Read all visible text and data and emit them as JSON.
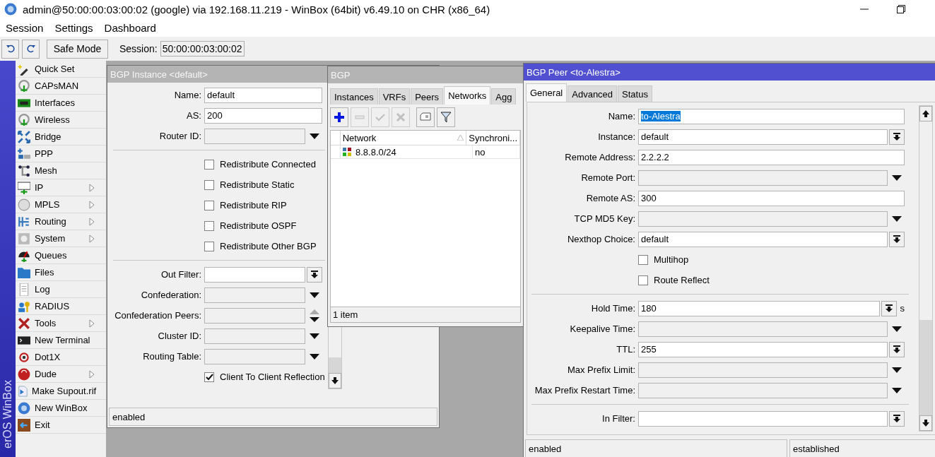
{
  "window": {
    "title": "admin@50:00:00:03:00:02 (google) via 192.168.11.219 - WinBox (64bit) v6.49.10 on CHR (x86_64)"
  },
  "menu": [
    "Session",
    "Settings",
    "Dashboard"
  ],
  "toolbar": {
    "safe_mode": "Safe Mode",
    "session_label": "Session:",
    "session_value": "50:00:00:03:00:02"
  },
  "sidebar": {
    "brand": "erOS WinBox",
    "items": [
      {
        "label": "Quick Set",
        "submenu": false
      },
      {
        "label": "CAPsMAN",
        "submenu": false
      },
      {
        "label": "Interfaces",
        "submenu": false
      },
      {
        "label": "Wireless",
        "submenu": false
      },
      {
        "label": "Bridge",
        "submenu": false
      },
      {
        "label": "PPP",
        "submenu": false
      },
      {
        "label": "Mesh",
        "submenu": false
      },
      {
        "label": "IP",
        "submenu": true
      },
      {
        "label": "MPLS",
        "submenu": true
      },
      {
        "label": "Routing",
        "submenu": true
      },
      {
        "label": "System",
        "submenu": true
      },
      {
        "label": "Queues",
        "submenu": false
      },
      {
        "label": "Files",
        "submenu": false
      },
      {
        "label": "Log",
        "submenu": false
      },
      {
        "label": "RADIUS",
        "submenu": false
      },
      {
        "label": "Tools",
        "submenu": true
      },
      {
        "label": "New Terminal",
        "submenu": false
      },
      {
        "label": "Dot1X",
        "submenu": false
      },
      {
        "label": "Dude",
        "submenu": true
      },
      {
        "label": "Make Supout.rif",
        "submenu": false
      },
      {
        "label": "New WinBox",
        "submenu": false
      },
      {
        "label": "Exit",
        "submenu": false
      }
    ]
  },
  "windows": [
    {
      "kind": "form",
      "title": "BGP Instance <default>",
      "active": false,
      "fields": [
        {
          "kind": "text",
          "label": "Name:",
          "value": "default"
        },
        {
          "kind": "text",
          "label": "AS:",
          "value": "200"
        },
        {
          "kind": "unset",
          "label": "Router ID:"
        },
        {
          "kind": "separator"
        },
        {
          "kind": "checkbox",
          "label": "Redistribute Connected",
          "checked": false
        },
        {
          "kind": "checkbox",
          "label": "Redistribute Static",
          "checked": false
        },
        {
          "kind": "checkbox",
          "label": "Redistribute RIP",
          "checked": false
        },
        {
          "kind": "checkbox",
          "label": "Redistribute OSPF",
          "checked": false
        },
        {
          "kind": "checkbox",
          "label": "Redistribute Other BGP",
          "checked": false
        },
        {
          "kind": "separator"
        },
        {
          "kind": "combo",
          "label": "Out Filter:"
        },
        {
          "kind": "unset",
          "label": "Confederation:"
        },
        {
          "kind": "multi",
          "label": "Confederation Peers:"
        },
        {
          "kind": "unset",
          "label": "Cluster ID:"
        },
        {
          "kind": "unset",
          "label": "Routing Table:"
        },
        {
          "kind": "checkbox",
          "label": "Client To Client Reflection",
          "checked": true
        }
      ],
      "status": [
        "enabled"
      ]
    },
    {
      "kind": "list",
      "title": "BGP",
      "active": false,
      "tabs": [
        {
          "label": "Instances",
          "selected": false
        },
        {
          "label": "VRFs",
          "selected": false
        },
        {
          "label": "Peers",
          "selected": false
        },
        {
          "label": "Networks",
          "selected": true
        },
        {
          "label": "Agg",
          "selected": false
        }
      ],
      "tools": [
        {
          "kind": "add",
          "disabled": false
        },
        {
          "kind": "remove",
          "disabled": true
        },
        {
          "kind": "enable",
          "disabled": true
        },
        {
          "kind": "disable",
          "disabled": true
        },
        {
          "kind": "comment",
          "disabled": false
        },
        {
          "kind": "filter",
          "disabled": false
        }
      ],
      "columns": [
        {
          "label": "Network",
          "sorted": true
        },
        {
          "label": "Synchroni...",
          "sorted": false
        }
      ],
      "rows": [
        {
          "cells": [
            "8.8.8.0/24",
            "no"
          ]
        }
      ],
      "status": [
        "1 item"
      ]
    },
    {
      "kind": "form",
      "title": "BGP Peer <to-Alestra>",
      "active": true,
      "tabs": [
        {
          "label": "General",
          "selected": true
        },
        {
          "label": "Advanced",
          "selected": false
        },
        {
          "label": "Status",
          "selected": false
        }
      ],
      "fields": [
        {
          "kind": "text",
          "label": "Name:",
          "value": "to-Alestra",
          "highlighted": true
        },
        {
          "kind": "combo",
          "label": "Instance:",
          "value": "default"
        },
        {
          "kind": "text",
          "label": "Remote Address:",
          "value": "2.2.2.2"
        },
        {
          "kind": "unset",
          "label": "Remote Port:"
        },
        {
          "kind": "text",
          "label": "Remote AS:",
          "value": "300"
        },
        {
          "kind": "unset",
          "label": "TCP MD5 Key:"
        },
        {
          "kind": "combo",
          "label": "Nexthop Choice:",
          "value": "default"
        },
        {
          "kind": "checkbox",
          "label": "Multihop",
          "checked": false
        },
        {
          "kind": "checkbox",
          "label": "Route Reflect",
          "checked": false
        },
        {
          "kind": "separator"
        },
        {
          "kind": "combo",
          "label": "Hold Time:",
          "value": "180",
          "unit": "s"
        },
        {
          "kind": "unset",
          "label": "Keepalive Time:"
        },
        {
          "kind": "combo",
          "label": "TTL:",
          "value": "255"
        },
        {
          "kind": "unset",
          "label": "Max Prefix Limit:"
        },
        {
          "kind": "unset",
          "label": "Max Prefix Restart Time:"
        },
        {
          "kind": "separator"
        },
        {
          "kind": "combo",
          "label": "In Filter:"
        }
      ],
      "status": [
        "enabled",
        "established"
      ]
    }
  ]
}
